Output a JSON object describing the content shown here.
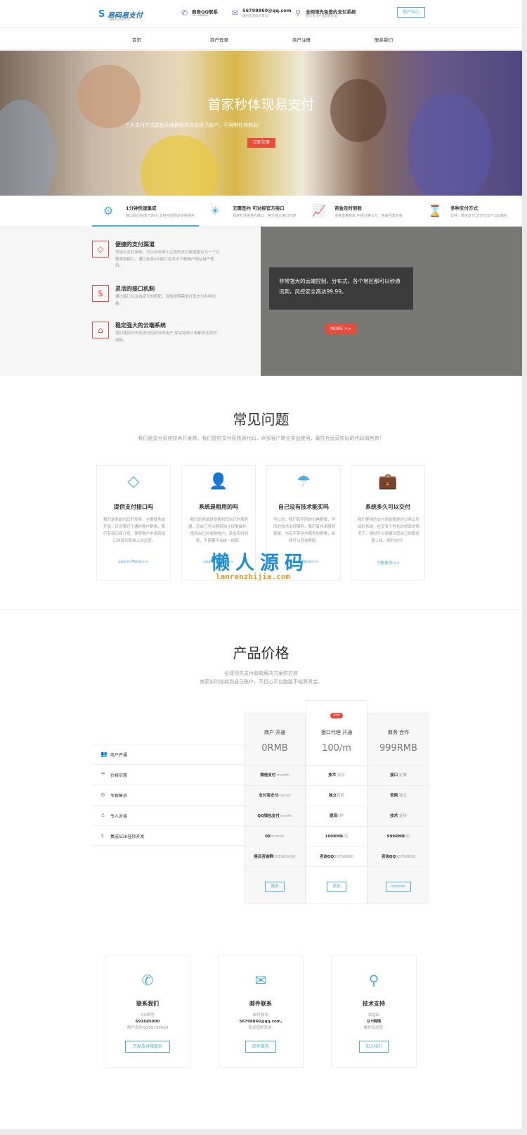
{
  "header": {
    "logo": {
      "mark": "S",
      "name": "易码易支付",
      "url": "www.ymyzf.cn"
    },
    "infos": [
      {
        "icon": "phone-icon",
        "glyph": "✆",
        "title": "商务QQ联系",
        "sub": "56798860"
      },
      {
        "icon": "mail-icon",
        "glyph": "✉",
        "title": "56798860@qq.com",
        "sub": "随时欢迎您的来信！"
      },
      {
        "icon": "location-pin-icon",
        "glyph": "⚲",
        "title": "全网领先免签约支付系统",
        "sub": "我们专注产品最好标准"
      }
    ],
    "merchant_btn": "商户中心"
  },
  "nav": [
    "首页",
    "商户登录",
    "商户注册",
    "联系我们"
  ],
  "hero": {
    "title": "首家秒体现易支付",
    "subtitle": "三大支付方式超低手续费秒体现到自己账户，不限制任何商品！",
    "button": "立即注册"
  },
  "features": [
    {
      "icon": "gear-icon",
      "glyph": "⚙",
      "title": "1分钟快速集成",
      "desc": "接口我们完成了99%,支持全部网站多种语言"
    },
    {
      "icon": "lightbulb-icon",
      "glyph": "☀",
      "title": "无需签约 可对接官方接口",
      "desc": "我家打造免签约接口，官方独立接口开通"
    },
    {
      "icon": "chart-icon",
      "glyph": "📈",
      "title": "资金及时到账",
      "desc": "资金直接到账,不经过第三方，快速回笼资金"
    },
    {
      "icon": "hourglass-icon",
      "glyph": "⌛",
      "title": "多种支付方式",
      "desc": "支持：微信支付,支付宝支付,QQ钱包"
    }
  ],
  "info_items": [
    {
      "icon": "diamond-icon",
      "glyph": "◇",
      "title": "便捷的支付渠道",
      "desc": "零接云支付系统，可以向市面上主流的支付渠道整合为一个付款渠道接口，通过标准API接口及双击下载商户网站用户使用。"
    },
    {
      "icon": "dollar-icon",
      "glyph": "$",
      "title": "灵活的接口机制",
      "desc": "通过接口以及自定义的搭配，轻松按照需求打造支付各种功能。"
    },
    {
      "icon": "bank-icon",
      "glyph": "⌂",
      "title": "稳定强大的云端系统",
      "desc": "我们使用分布式进行控制分布用户,保证每单订单都安全及时到账。"
    }
  ],
  "info_card": {
    "text": "非常强大的云端控制，分布式，各个地区都可以秒通讯到，风控安全高达99.99。",
    "more": "MORE >>"
  },
  "faq": {
    "title": "常见问题",
    "subtitle": "我们是支付系统技术开发商，我们提供支付系统源代码，众多客户商业实战使用，最符合运营实际的代码销售商！",
    "items": [
      {
        "icon": "diamond-icon",
        "glyph": "◇",
        "title": "提供支付接口吗",
        "desc": "我们是系统代码开发商，主要做系统开发，针对我们于通的客户群体，我们有接口商介绍，保障客户申请到接口对接到系统上线运营。",
        "link": "Learn More>>"
      },
      {
        "icon": "user-icon",
        "glyph": "👤",
        "title": "系统是租用的吗",
        "desc": "我们的系统是部署到您自己的服务器，您自己可以拥有独立权限操作，使用自己的收款账户，资金实时到账，不需要平台统一结算。",
        "link": "Learn More>>"
      },
      {
        "icon": "umbrella-icon",
        "glyph": "☂",
        "title": "自己没有技术能买吗",
        "desc": "可以的，我们有不同的价格套餐，不同的技术支持服务，我们有技术服务套餐，也有不带技术服务的套餐，具体可以咨询客服。",
        "link": "Learn More>>"
      },
      {
        "icon": "briefcase-icon",
        "glyph": "💼",
        "title": "系统多久可以交付",
        "desc": "我们使用的支付系统都是经过商业实战的系统，在没有个性化的修改的情况下，随时可以部署到您自己的服务器上线，随时交付！",
        "link": "了解更多>>"
      }
    ]
  },
  "watermark": {
    "cn": "懒人源码",
    "en": "lanrenzhijia.com"
  },
  "pricing": {
    "title": "产品价格",
    "sub1": "全球领先支付收款解决方案供应商",
    "sub2": "商家实时收款到自己账户，不担心平台跑路不结算资金。",
    "labels": [
      {
        "icon": "users-icon",
        "glyph": "👥",
        "text": "商户开通"
      },
      {
        "icon": "umbrella-icon",
        "glyph": "☂",
        "text": "价格实惠"
      },
      {
        "icon": "support-icon",
        "glyph": "⊕",
        "text": "专群售后"
      },
      {
        "icon": "anchor-icon",
        "glyph": "⚓",
        "text": "专人对接"
      },
      {
        "icon": "dollar-icon",
        "glyph": "$",
        "text": "集成SDK任你开发"
      }
    ],
    "columns": [
      {
        "name": "商户 开通",
        "price": "0RMB",
        "rows": [
          [
            "微信支付",
            "month"
          ],
          [
            "支付宝支付",
            "month"
          ],
          [
            "QQ钱包支付",
            "month"
          ],
          [
            "0R",
            "/month"
          ],
          [
            "售后咨询群",
            "691685000"
          ]
        ],
        "button": "更多"
      },
      {
        "name": "接口代理 开通",
        "badge": "new",
        "price": "100/m",
        "rows": [
          [
            "技术",
            "支持"
          ],
          [
            "独立",
            "官网"
          ],
          [
            "提现",
            "0秒"
          ],
          [
            "100RMB",
            "/位"
          ],
          [
            "咨询QQ",
            "56798860"
          ]
        ],
        "button": "更多"
      },
      {
        "name": "商务 合作",
        "price": "999RMB",
        "rows": [
          [
            "接口",
            "定做"
          ],
          [
            "官网",
            "独立"
          ],
          [
            "技术",
            "支持"
          ],
          [
            "999RMB",
            "/位"
          ],
          [
            "咨询QQ",
            "56798860"
          ]
        ],
        "button": "choose"
      }
    ]
  },
  "contact": [
    {
      "icon": "phone-icon",
      "glyph": "✆",
      "title": "联系我们",
      "l1": "QQ群号",
      "l2": "691685000",
      "l3": "商户合作QQ56798860",
      "button": "开发及对接联系"
    },
    {
      "icon": "mail-icon",
      "glyph": "✉",
      "title": "邮件联系",
      "l1": "邮件联系",
      "l2": "56798860@qq.com,",
      "l3": "欢迎您的来信.",
      "button": "邮件联系"
    },
    {
      "icon": "location-pin-icon",
      "glyph": "⚲",
      "title": "技术支持",
      "l1": "本站由",
      "l2": "以Y网络",
      "l3": "维护及运营.",
      "button": "加入我们"
    }
  ]
}
